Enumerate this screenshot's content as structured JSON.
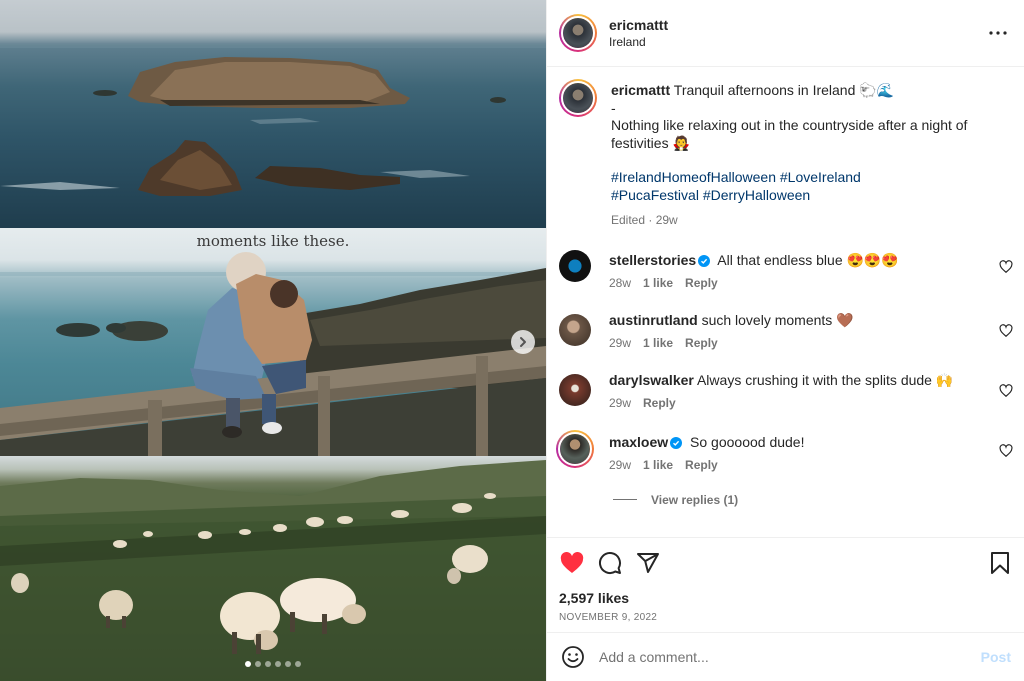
{
  "post": {
    "username": "ericmattt",
    "location": "Ireland",
    "overlay_text": "moments like these.",
    "caption": {
      "username": "ericmattt",
      "text_line1": "Tranquil afternoons in Ireland 🐑🌊",
      "text_line2": "-",
      "text_line3": "Nothing like relaxing out in the countryside after a night of festivities 🧛",
      "hashtags": [
        "#IrelandHomeofHalloween",
        "#LoveIreland",
        "#PucaFestival",
        "#DerryHalloween"
      ],
      "meta": "Edited · 29w"
    },
    "carousel": {
      "total": 6,
      "active": 0
    }
  },
  "comments": [
    {
      "username": "stellerstories",
      "verified": true,
      "text": "All that endless blue 😍😍😍",
      "time": "28w",
      "likes": "1 like",
      "reply": "Reply",
      "avatar_color": "#111111"
    },
    {
      "username": "austinrutland",
      "verified": false,
      "text": "such lovely moments 🤎",
      "time": "29w",
      "likes": "1 like",
      "reply": "Reply",
      "avatar_color": "#6b5646"
    },
    {
      "username": "darylswalker",
      "verified": false,
      "text": "Always crushing it with the splits dude 🙌",
      "time": "29w",
      "likes": "",
      "reply": "Reply",
      "avatar_color": "#7a3b2e"
    },
    {
      "username": "maxloew",
      "verified": true,
      "text": "So goooood dude!",
      "time": "29w",
      "likes": "1 like",
      "reply": "Reply",
      "avatar_color": "#3b403d"
    }
  ],
  "view_replies": "View replies (1)",
  "actions": {
    "likes": "2,597 likes",
    "date": "NOVEMBER 9, 2022"
  },
  "add_comment": {
    "placeholder": "Add a comment...",
    "post_label": "Post"
  },
  "colors": {
    "like_red": "#ff3040",
    "link_blue": "#00376b",
    "verified_blue": "#0095f6",
    "post_disabled": "#c0dffd"
  },
  "icons": [
    "more-icon",
    "heart-icon",
    "comment-icon",
    "share-icon",
    "bookmark-icon",
    "emoji-icon",
    "chevron-right-icon",
    "verified-icon"
  ]
}
